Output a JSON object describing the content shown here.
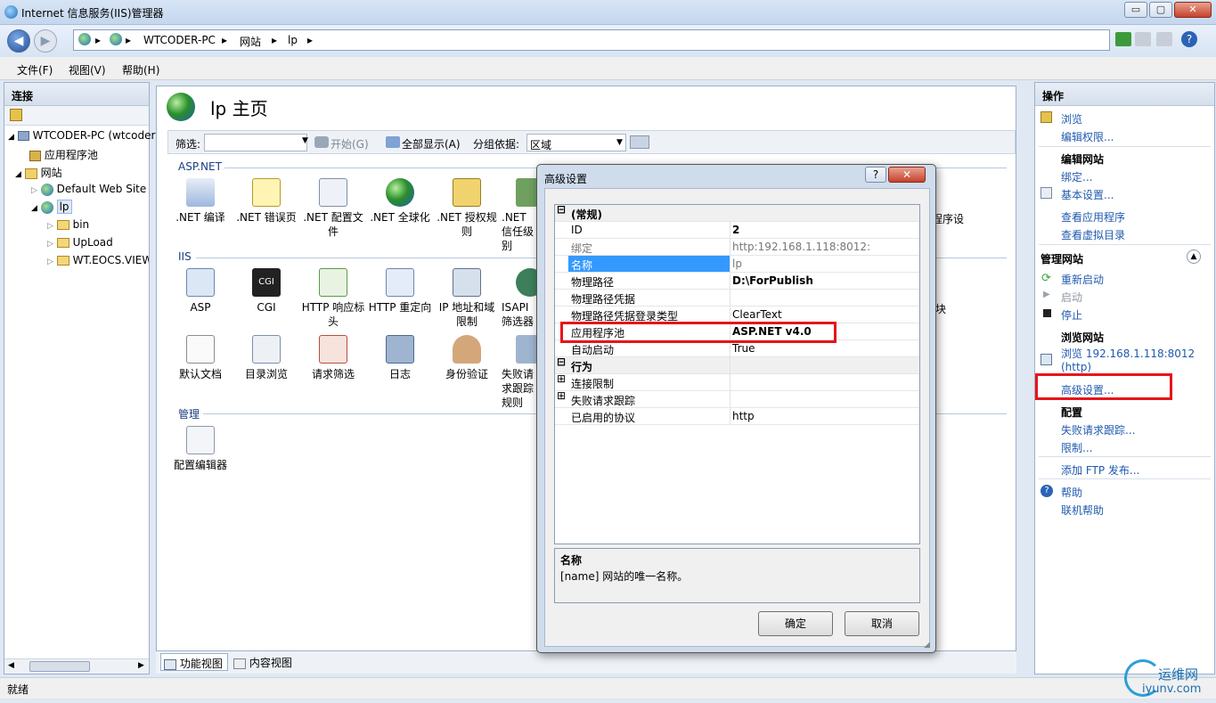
{
  "window": {
    "title": "Internet 信息服务(IIS)管理器",
    "min": "▭",
    "max": "▢",
    "close": "✕"
  },
  "address": {
    "segments": [
      "WTCODER-PC",
      "网站",
      "lp"
    ],
    "sep": "▸"
  },
  "menu": [
    "文件(F)",
    "视图(V)",
    "帮助(H)"
  ],
  "left": {
    "header": "连接",
    "tree": [
      {
        "label": "WTCODER-PC (wtcoder",
        "level": 0,
        "icon": "computer-icon"
      },
      {
        "label": "应用程序池",
        "level": 1,
        "icon": "app-pool-icon"
      },
      {
        "label": "网站",
        "level": 1,
        "icon": "sites-folder-icon"
      },
      {
        "label": "Default Web Site",
        "level": 2,
        "icon": "globe-icon"
      },
      {
        "label": "lp",
        "level": 2,
        "icon": "globe-icon"
      },
      {
        "label": "bin",
        "level": 3,
        "icon": "folder-icon"
      },
      {
        "label": "UpLoad",
        "level": 3,
        "icon": "folder-icon"
      },
      {
        "label": "WT.EOCS.VIEW",
        "level": 3,
        "icon": "folder-icon"
      }
    ]
  },
  "center": {
    "title": "lp 主页",
    "filter": {
      "label": "筛选:",
      "start": "开始(G)",
      "showall": "全部显示(A)",
      "groupby_label": "分组依据:",
      "groupby_value": "区域"
    },
    "groups": [
      {
        "name": "ASP.NET",
        "items": [
          ".NET 编译",
          ".NET 错误页",
          ".NET 配置文件",
          ".NET 全球化",
          ".NET 授权规则",
          ".NET 信任级别"
        ]
      },
      {
        "name": "IIS",
        "items": [
          "ASP",
          "CGI",
          "HTTP 响应标头",
          "HTTP 重定向",
          "IP 地址和域限制",
          "ISAPI 筛选器"
        ]
      },
      {
        "name": "IIS_row2",
        "items": [
          "默认文档",
          "目录浏览",
          "请求筛选",
          "日志",
          "身份验证",
          "失败请求跟踪规则"
        ]
      },
      {
        "name": "管理",
        "items": [
          "配置编辑器"
        ]
      }
    ],
    "partial": {
      "asp_right": "程序设置",
      "iis_right": "块"
    }
  },
  "tabs": {
    "feature": "功能视图",
    "content": "内容视图"
  },
  "right": {
    "header": "操作",
    "browse": "浏览",
    "edit_perm": "编辑权限...",
    "edit_site": "编辑网站",
    "binding": "绑定...",
    "basic": "基本设置...",
    "view_apps": "查看应用程序",
    "view_vdirs": "查看虚拟目录",
    "manage_site": "管理网站",
    "restart": "重新启动",
    "start": "启动",
    "stop": "停止",
    "browse_site": "浏览网站",
    "browse_url": "浏览 192.168.1.118:8012",
    "browse_http": "(http)",
    "advanced": "高级设置...",
    "config": "配置",
    "failed_trace": "失败请求跟踪...",
    "limits": "限制...",
    "add_ftp": "添加 FTP 发布...",
    "help": "帮助",
    "online_help": "联机帮助"
  },
  "status": "就绪",
  "dialog": {
    "title": "高级设置",
    "help": "?",
    "close": "✕",
    "rows": [
      {
        "type": "cat",
        "exp": "⊟",
        "label": "(常规)"
      },
      {
        "label": "ID",
        "value": "2",
        "bold": true
      },
      {
        "label": "绑定",
        "value": "http:192.168.1.118:8012:",
        "gray": true
      },
      {
        "label": "名称",
        "value": "lp",
        "selected": true,
        "gray": true
      },
      {
        "label": "物理路径",
        "value": "D:\\ForPublish",
        "bold": true
      },
      {
        "label": "物理路径凭据",
        "value": ""
      },
      {
        "label": "物理路径凭据登录类型",
        "value": "ClearText"
      },
      {
        "label": "应用程序池",
        "value": "ASP.NET v4.0",
        "bold": true
      },
      {
        "label": "自动启动",
        "value": "True"
      },
      {
        "type": "cat",
        "exp": "⊟",
        "label": "行为"
      },
      {
        "exp": "⊞",
        "label": "连接限制",
        "value": ""
      },
      {
        "exp": "⊞",
        "label": "失败请求跟踪",
        "value": ""
      },
      {
        "label": "已启用的协议",
        "value": "http"
      }
    ],
    "desc_title": "名称",
    "desc_text": "[name] 网站的唯一名称。",
    "ok": "确定",
    "cancel": "取消"
  },
  "watermark": {
    "cn": "运维网",
    "url": "iyunv.com"
  }
}
